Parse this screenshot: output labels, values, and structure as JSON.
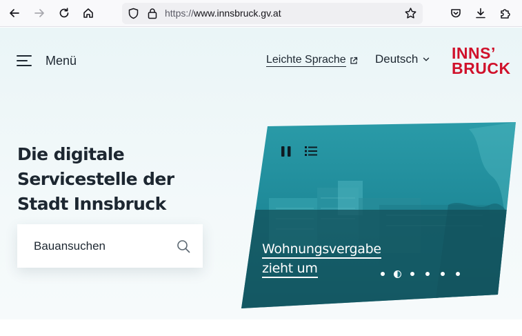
{
  "browser": {
    "url_protocol": "https://",
    "url_host": "www.innsbruck.gv.at"
  },
  "header": {
    "menu_label": "Menü",
    "easy_language_label": "Leichte Sprache",
    "language_selected": "Deutsch",
    "logo_line1": "INNS’",
    "logo_line2": "BRUCK",
    "brand_color": "#d0112b"
  },
  "hero": {
    "title": "Die digitale Servicestelle der Stadt Innsbruck",
    "search": {
      "value": "Bauansuchen",
      "placeholder": ""
    }
  },
  "slider": {
    "caption_line1": "Wohnungsvergabe",
    "caption_line2": "zieht um",
    "slide_count": 6,
    "active_slide": 2,
    "controls": [
      "pause-icon",
      "list-icon"
    ],
    "accent_color": "#1f8a99"
  },
  "icons": {
    "back": "arrow-left-icon",
    "forward": "arrow-right-icon",
    "reload": "reload-icon",
    "home": "home-icon",
    "shield": "shield-icon",
    "lock": "lock-icon",
    "bookmark": "star-icon",
    "pocket": "pocket-icon",
    "download": "download-icon",
    "extensions": "puzzle-icon"
  }
}
